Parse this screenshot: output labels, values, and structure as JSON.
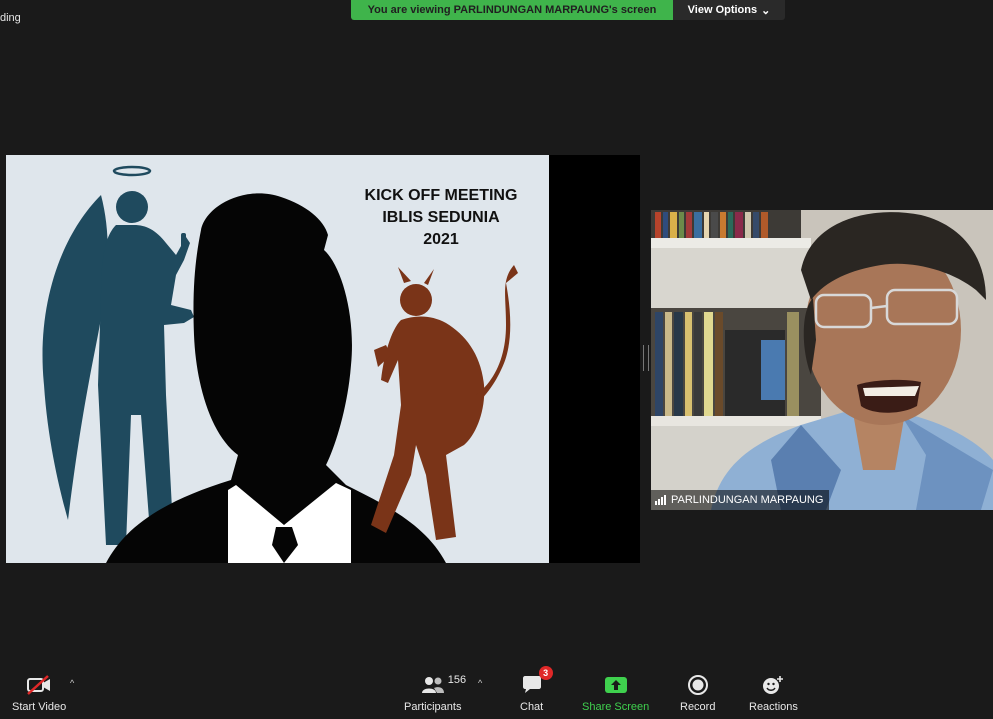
{
  "recording_label": "ding",
  "banner": {
    "text": "You are viewing PARLINDUNGAN MARPAUNG's screen"
  },
  "view_options": {
    "label": "View Options",
    "caret": "⌄"
  },
  "slide": {
    "title_lines": [
      "KICK OFF MEETING",
      "IBLIS SEDUNIA",
      "2021"
    ]
  },
  "participant": {
    "name": "PARLINDUNGAN MARPAUNG"
  },
  "toolbar": {
    "start_video": {
      "label": "Start Video"
    },
    "participants": {
      "label": "Participants",
      "count": "156"
    },
    "chat": {
      "label": "Chat",
      "badge": "3"
    },
    "share_screen": {
      "label": "Share Screen"
    },
    "record": {
      "label": "Record"
    },
    "reactions": {
      "label": "Reactions"
    }
  },
  "colors": {
    "banner": "#3fb44b",
    "share_green": "#3fd14e",
    "badge_red": "#e02828",
    "slide_bg": "#dfe6ec"
  }
}
